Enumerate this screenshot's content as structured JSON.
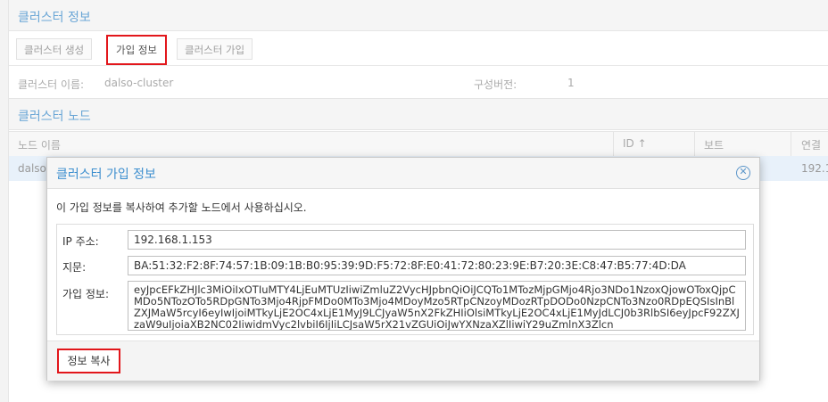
{
  "cluster_info": {
    "title": "클러스터 정보",
    "toolbar": {
      "create_label": "클러스터 생성",
      "join_info_label": "가입 정보",
      "join_label": "클러스터 가입"
    },
    "name_label": "클러스터 이름:",
    "name_value": "dalso-cluster",
    "version_label": "구성버전:",
    "version_value": "1"
  },
  "cluster_nodes": {
    "title": "클러스터 노드",
    "columns": {
      "name": "노드 이름",
      "id": "ID ↑",
      "vote": "보트",
      "link": "연결"
    },
    "row": {
      "name": "dalso",
      "link": "192.1"
    }
  },
  "dialog": {
    "title": "클러스터 가입 정보",
    "message": "이 가입 정보를 복사하여 추가할 노드에서 사용하십시오.",
    "ip_label": "IP 주소:",
    "ip_value": "192.168.1.153",
    "fingerprint_label": "지문:",
    "fingerprint_value": "BA:51:32:F2:8F:74:57:1B:09:1B:B0:95:39:9D:F5:72:8F:E0:41:72:80:23:9E:B7:20:3E:C8:47:B5:77:4D:DA",
    "join_info_label": "가입 정보:",
    "join_info_value": "eyJpcEFkZHJlc3MiOiIxOTIuMTY4LjEuMTUzIiwiZmluZ2VycHJpbnQiOiJCQTo1MTozMjpGMjo4Rjo3NDo1NzoxQjowOToxQjpCMDo5NTozOTo5RDpGNTo3Mjo4RjpFMDo0MTo3Mjo4MDoyMzo5RTpCNzoyMDozRTpDODo0NzpCNTo3Nzo0RDpEQSIsInBlZXJMaW5rcyI6eyIwIjoiMTkyLjE2OC4xLjE1MyJ9LCJyaW5nX2FkZHIiOlsiMTkyLjE2OC4xLjE1MyJdLCJ0b3RlbSI6eyJpcF92ZXJzaW9uIjoiaXB2NC02IiwidmVyc2lvbiI6IjIiLCJsaW5rX21vZGUiOiJwYXNzaXZlIiwiY29uZmlnX3Zlcn",
    "copy_button_label": "정보 복사",
    "close_icon": "close-circle-icon"
  }
}
